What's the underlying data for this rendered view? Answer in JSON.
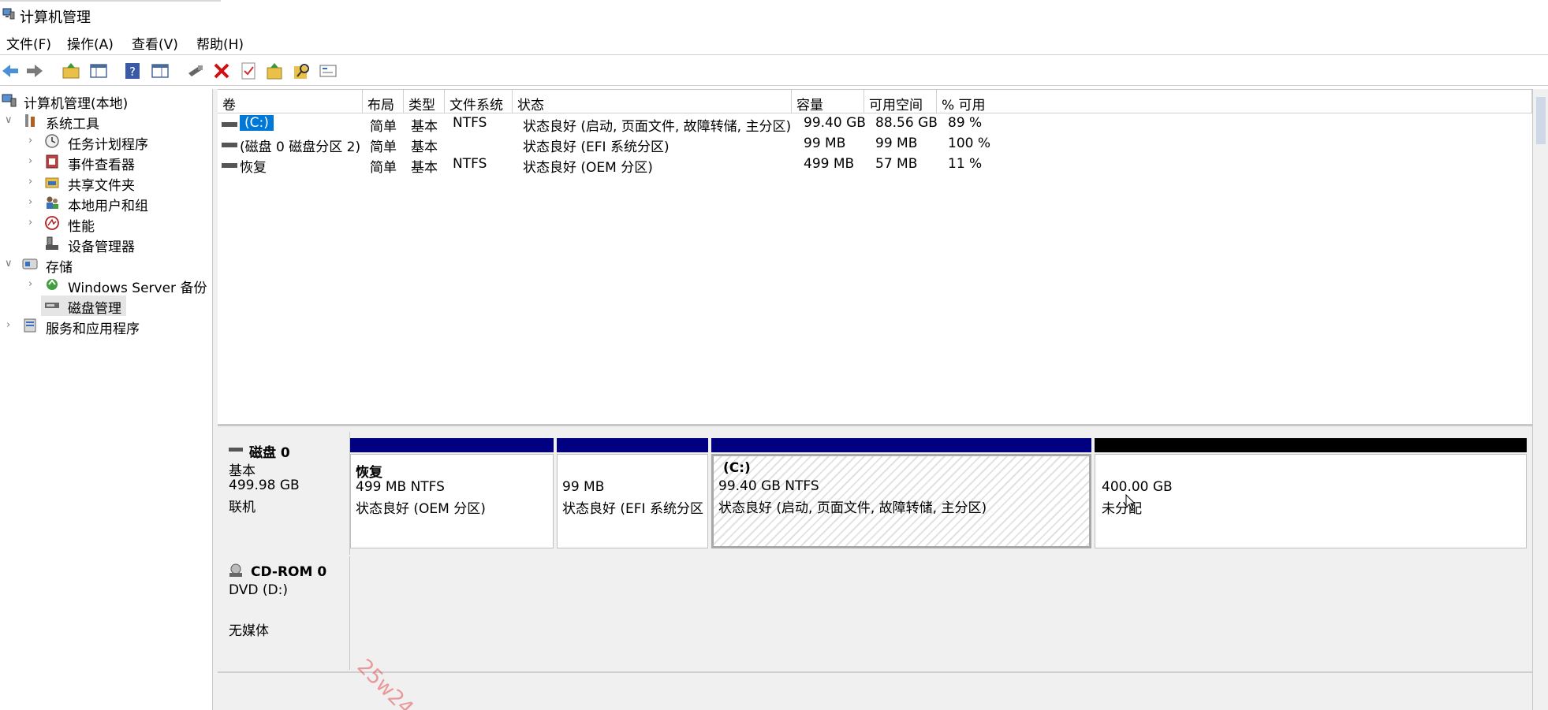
{
  "window": {
    "title": "计算机管理"
  },
  "menu": [
    "文件(F)",
    "操作(A)",
    "查看(V)",
    "帮助(H)"
  ],
  "toolbar": [
    "back-icon",
    "forward-icon",
    "up-folder-icon",
    "show-hide-tree-icon",
    "help-icon",
    "properties-pane-icon",
    "connect-icon",
    "delete-icon",
    "check-icon",
    "export-icon",
    "search-icon",
    "settings-icon"
  ],
  "tree": {
    "root": "计算机管理(本地)",
    "system_tools": "系统工具",
    "task_scheduler": "任务计划程序",
    "event_viewer": "事件查看器",
    "shared_folders": "共享文件夹",
    "local_users": "本地用户和组",
    "performance": "性能",
    "device_manager": "设备管理器",
    "storage": "存储",
    "wsb": "Windows Server 备份",
    "disk_mgmt": "磁盘管理",
    "services": "服务和应用程序"
  },
  "columns": [
    "卷",
    "布局",
    "类型",
    "文件系统",
    "状态",
    "容量",
    "可用空间",
    "% 可用"
  ],
  "volumes": [
    {
      "name": "(C:)",
      "layout": "简单",
      "type": "基本",
      "fs": "NTFS",
      "status": "状态良好 (启动, 页面文件, 故障转储, 主分区)",
      "capacity": "99.40 GB",
      "free": "88.56 GB",
      "pct": "89 %"
    },
    {
      "name": "(磁盘 0 磁盘分区 2)",
      "layout": "简单",
      "type": "基本",
      "fs": "",
      "status": "状态良好 (EFI 系统分区)",
      "capacity": "99 MB",
      "free": "99 MB",
      "pct": "100 %"
    },
    {
      "name": "恢复",
      "layout": "简单",
      "type": "基本",
      "fs": "NTFS",
      "status": "状态良好 (OEM 分区)",
      "capacity": "499 MB",
      "free": "57 MB",
      "pct": "11 %"
    }
  ],
  "disk0": {
    "name": "磁盘 0",
    "type": "基本",
    "size": "499.98 GB",
    "state": "联机",
    "partitions": [
      {
        "title": "恢复",
        "line1": "499 MB NTFS",
        "line2": "状态良好 (OEM 分区)"
      },
      {
        "title": "",
        "line1": "99 MB",
        "line2": "状态良好 (EFI 系统分区"
      },
      {
        "title": "(C:)",
        "line1": "99.40 GB NTFS",
        "line2": "状态良好 (启动, 页面文件, 故障转储, 主分区)"
      },
      {
        "title": "",
        "line1": "400.00 GB",
        "line2": "未分配"
      }
    ]
  },
  "cdrom0": {
    "name": "CD-ROM 0",
    "drive": "DVD (D:)",
    "media": "无媒体"
  },
  "watermark": "25w24",
  "colors": {
    "primary_bar": "#000080",
    "unallocated_bar": "#000000",
    "selection": "#0078d7"
  }
}
